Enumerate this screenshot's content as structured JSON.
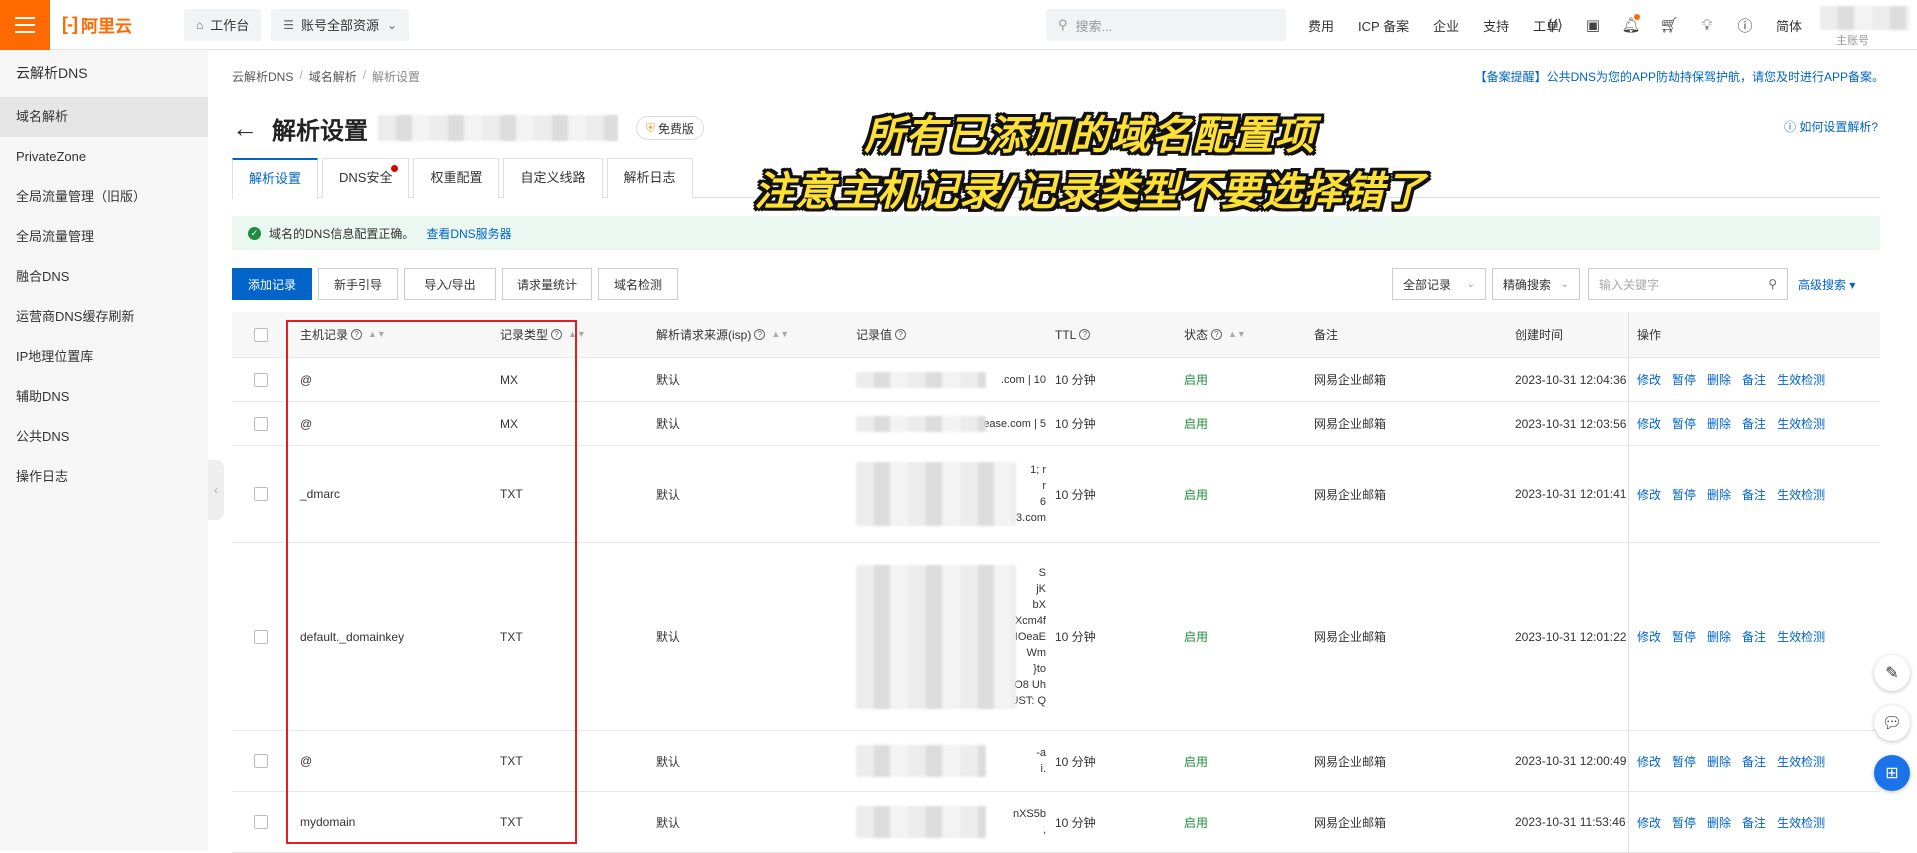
{
  "topbar": {
    "logo_mark": "[-]",
    "logo_text": "阿里云",
    "workbench_label": "工作台",
    "resource_label": "账号全部资源",
    "search_placeholder": "搜索...",
    "links": [
      "费用",
      "ICP 备案",
      "企业",
      "支持",
      "工单"
    ],
    "lang": "简体",
    "account_name": "主账号"
  },
  "sidebar": {
    "title": "云解析DNS",
    "items": [
      {
        "label": "域名解析",
        "active": true
      },
      {
        "label": "PrivateZone"
      },
      {
        "label": "全局流量管理（旧版）"
      },
      {
        "label": "全局流量管理"
      },
      {
        "label": "融合DNS"
      },
      {
        "label": "运营商DNS缓存刷新"
      },
      {
        "label": "IP地理位置库"
      },
      {
        "label": "辅助DNS"
      },
      {
        "label": "公共DNS"
      },
      {
        "label": "操作日志"
      }
    ]
  },
  "breadcrumb": [
    "云解析DNS",
    "域名解析",
    "解析设置"
  ],
  "notice": "【备案提醒】公共DNS为您的APP防劫持保驾护航，请您及时进行APP备案。",
  "page": {
    "title": "解析设置",
    "badge": "免费版",
    "help": "如何设置解析?"
  },
  "tabs": [
    {
      "label": "解析设置",
      "active": true
    },
    {
      "label": "DNS安全",
      "dot": true
    },
    {
      "label": "权重配置"
    },
    {
      "label": "自定义线路"
    },
    {
      "label": "解析日志"
    }
  ],
  "status": {
    "message": "域名的DNS信息配置正确。",
    "link": "查看DNS服务器"
  },
  "toolbar": {
    "add": "添加记录",
    "guide": "新手引导",
    "import_export": "导入/导出",
    "stats": "请求量统计",
    "check": "域名检测",
    "filter_all": "全部记录",
    "filter_precise": "精确搜索",
    "keyword_placeholder": "输入关键字",
    "advanced": "高级搜索"
  },
  "table": {
    "headers": {
      "host": "主机记录",
      "type": "记录类型",
      "isp": "解析请求来源(isp)",
      "value": "记录值",
      "ttl": "TTL",
      "status": "状态",
      "remark": "备注",
      "created": "创建时间",
      "ops": "操作"
    },
    "ops": [
      "修改",
      "暂停",
      "删除",
      "备注",
      "生效检测"
    ],
    "rows": [
      {
        "host": "@",
        "type": "MX",
        "isp": "默认",
        "value_lines": [
          ".com | 10"
        ],
        "ttl": "10 分钟",
        "status": "启用",
        "remark": "网易企业邮箱",
        "created": "2023-10-31 12:04:36"
      },
      {
        "host": "@",
        "type": "MX",
        "isp": "默认",
        "value_lines": [
          "ease.com | 5"
        ],
        "ttl": "10 分钟",
        "status": "启用",
        "remark": "网易企业邮箱",
        "created": "2023-10-31 12:03:56"
      },
      {
        "host": "_dmarc",
        "type": "TXT",
        "isp": "默认",
        "value_lines": [
          "1; r",
          "r",
          "6",
          "3.com"
        ],
        "ttl": "10 分钟",
        "status": "启用",
        "remark": "网易企业邮箱",
        "created": "2023-10-31 12:01:41"
      },
      {
        "host": "default._domainkey",
        "type": "TXT",
        "isp": "默认",
        "value_lines": [
          "S",
          "jK",
          "bX",
          "E Xcm4f",
          "+IOeaE",
          "Wm",
          "}to",
          "6O8 Uh",
          "UST: Q"
        ],
        "ttl": "10 分钟",
        "status": "启用",
        "remark": "网易企业邮箱",
        "created": "2023-10-31 12:01:22"
      },
      {
        "host": "@",
        "type": "TXT",
        "isp": "默认",
        "value_lines": [
          "-a",
          "i."
        ],
        "ttl": "10 分钟",
        "status": "启用",
        "remark": "网易企业邮箱",
        "created": "2023-10-31 12:00:49"
      },
      {
        "host": "mydomain",
        "type": "TXT",
        "isp": "默认",
        "value_lines": [
          "nXS5b",
          ","
        ],
        "ttl": "10 分钟",
        "status": "启用",
        "remark": "网易企业邮箱",
        "created": "2023-10-31 11:53:46"
      }
    ]
  },
  "annotation": {
    "line1": "所有已添加的域名配置项",
    "line2": "注意主机记录/记录类型不要选择错了"
  },
  "colors": {
    "brand": "#ff6a00",
    "primary": "#0064c8",
    "success": "#1e8e3e",
    "highlight_box": "#e02020",
    "annotation_text": "#ffe135"
  }
}
